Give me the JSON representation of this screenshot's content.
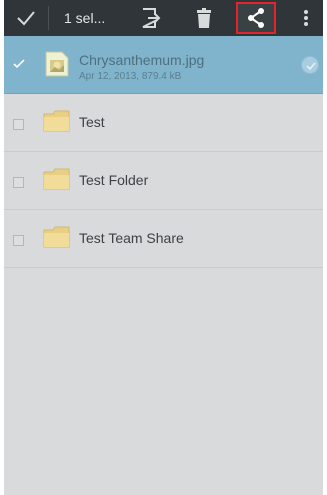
{
  "actionbar": {
    "selected_count": "1 sel...",
    "icons": [
      "check-icon",
      "move-icon",
      "delete-icon",
      "share-icon",
      "overflow-menu-icon"
    ]
  },
  "files": [
    {
      "name": "Chrysanthemum.jpg",
      "meta": "Apr 12, 2013, 879.4 kB",
      "type": "image",
      "selected": true
    },
    {
      "name": "Test",
      "type": "folder",
      "selected": false
    },
    {
      "name": "Test Folder",
      "type": "folder",
      "selected": false
    },
    {
      "name": "Test Team Share",
      "type": "folder",
      "selected": false
    }
  ],
  "colors": {
    "actionbar_bg": "#2f3538",
    "selected_row_bg": "#7fb4cc",
    "list_bg": "#d8dadb",
    "highlight_border": "#e0262b"
  }
}
